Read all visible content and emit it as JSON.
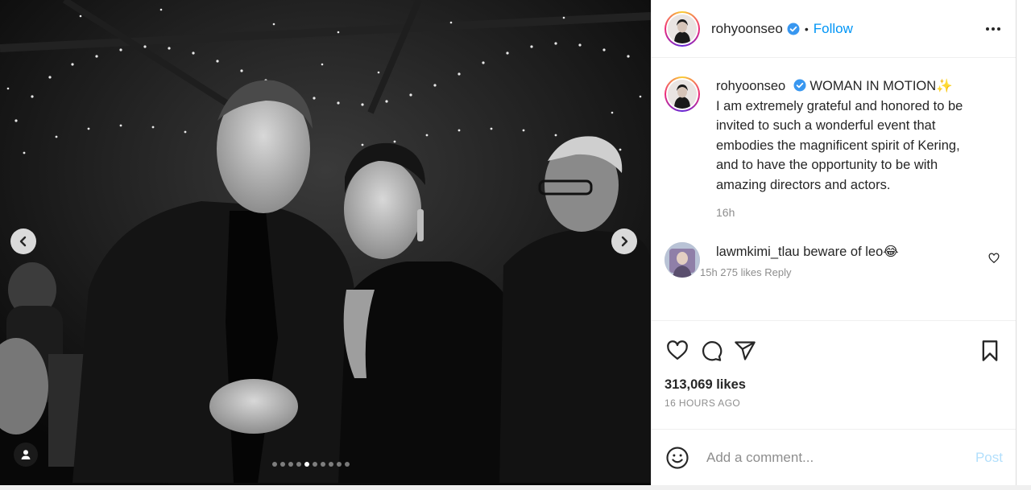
{
  "post": {
    "username": "rohyoonseo",
    "separator": "•",
    "follow_label": "Follow",
    "caption_title": "WOMAN IN MOTION✨",
    "caption_body": "I am extremely grateful and honored to be invited to such a wonderful event that embodies the magnificent spirit of Kering, and to have the opportunity to be with amazing directors and actors.",
    "time": "16h",
    "likes": "313,069 likes",
    "posted_ago": "16 HOURS AGO"
  },
  "comment": {
    "username": "lawmkimi_tlau",
    "text": "beware of leo😂",
    "meta": "15h   275 likes   Reply"
  },
  "composer": {
    "placeholder": "Add a comment...",
    "post_label": "Post"
  },
  "carousel": {
    "slide_count": 10,
    "active_index": 4
  },
  "colors": {
    "link_blue": "#0095f6",
    "post_disabled": "#b2dffc",
    "muted": "#8e8e8e",
    "verified_blue": "#3897f0"
  },
  "icons": [
    "chevron-left-icon",
    "chevron-right-icon",
    "user-tag-icon",
    "verified-badge-icon",
    "more-options-icon",
    "heart-icon",
    "comment-icon",
    "share-icon",
    "bookmark-icon",
    "emoji-icon"
  ]
}
